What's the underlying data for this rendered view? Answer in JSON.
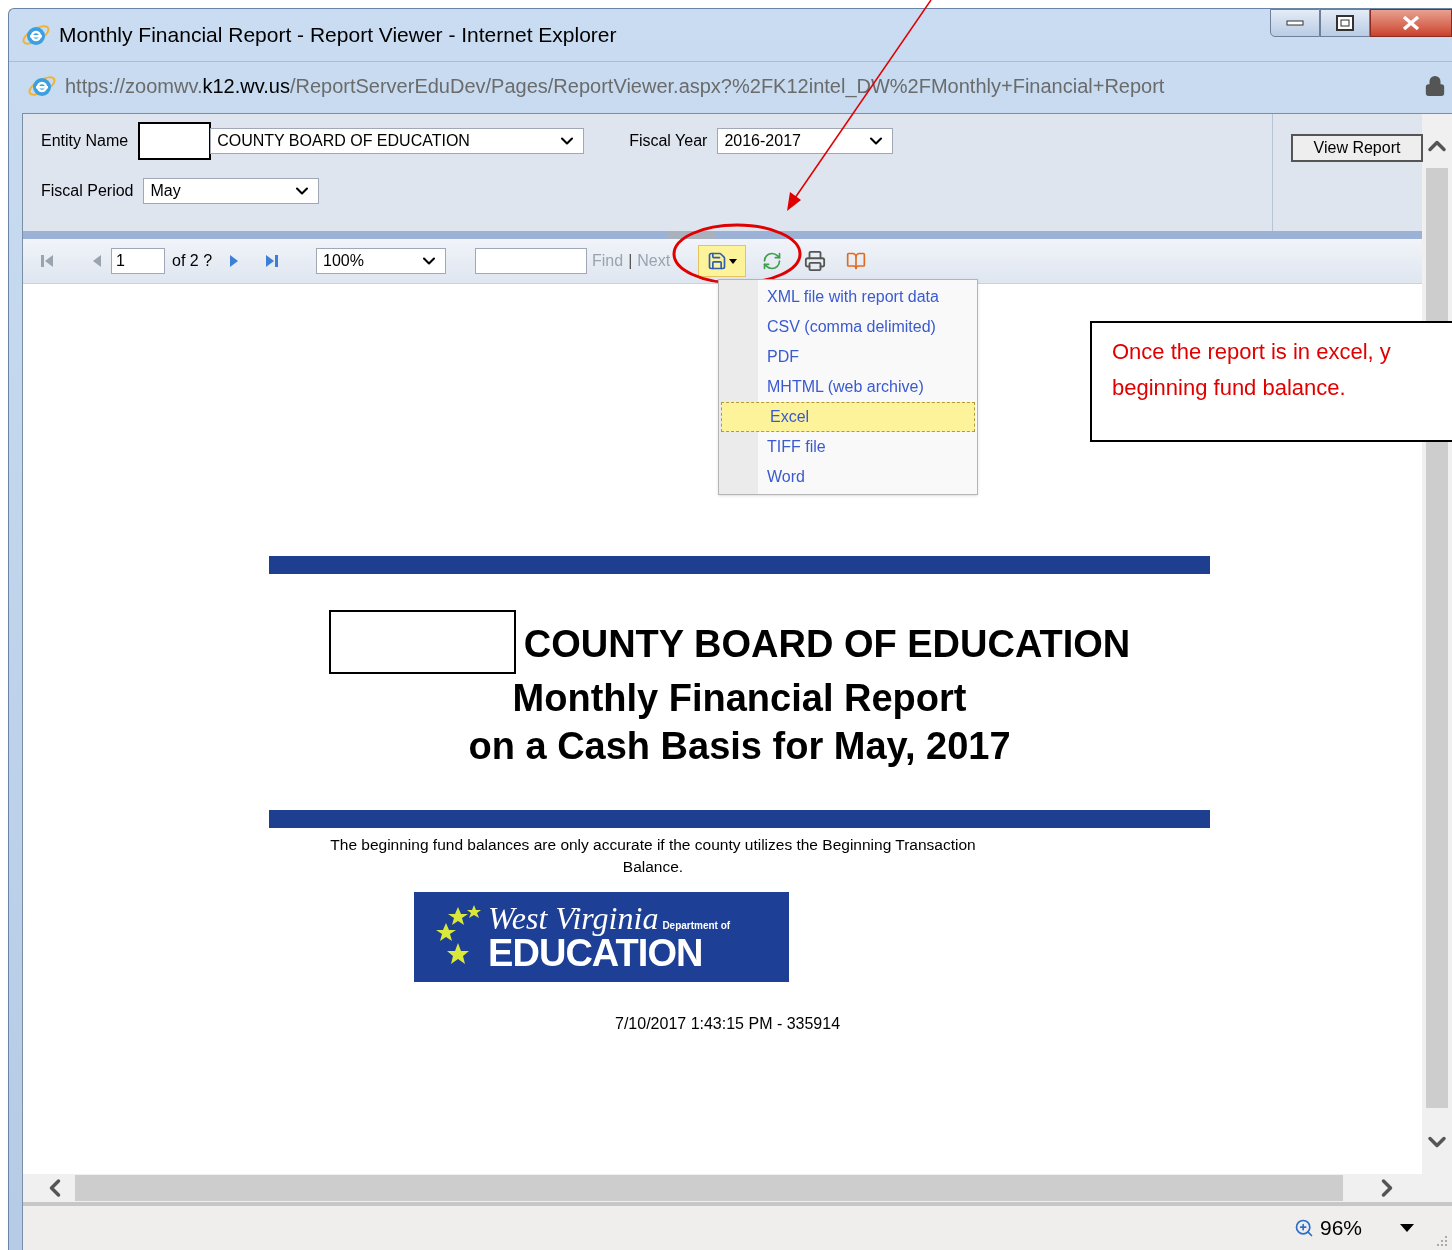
{
  "window": {
    "title": "Monthly Financial Report - Report Viewer - Internet Explorer"
  },
  "address_bar": {
    "url_parts": [
      {
        "text": "https://zoomwv.",
        "emphasis": false
      },
      {
        "text": "k12.wv.us",
        "emphasis": true
      },
      {
        "text": "/ReportServerEduDev/Pages/ReportViewer.aspx?%2FK12intel_DW%2FMonthly+Financial+Report",
        "emphasis": false
      }
    ]
  },
  "parameters": [
    {
      "label": "Entity Name",
      "value": "COUNTY BOARD OF EDUCATION",
      "redacted": true
    },
    {
      "label": "Fiscal Year",
      "value": "2016-2017"
    },
    {
      "label": "Fiscal Period",
      "value": "May"
    }
  ],
  "view_report_button": "View Report",
  "toolbar": {
    "page": "1",
    "page_count": "of 2 ?",
    "zoom": "100%",
    "find": {
      "label": "Find",
      "disabled": true
    },
    "separator": "|",
    "next": {
      "label": "Next",
      "disabled": true
    }
  },
  "export_menu": {
    "open": true,
    "items": [
      {
        "label": "XML file with report data",
        "selected": false
      },
      {
        "label": "CSV (comma delimited)",
        "selected": false
      },
      {
        "label": "PDF",
        "selected": false
      },
      {
        "label": "MHTML (web archive)",
        "selected": false
      },
      {
        "label": "Excel",
        "selected": true
      },
      {
        "label": "TIFF file",
        "selected": false
      },
      {
        "label": "Word",
        "selected": false
      }
    ]
  },
  "report": {
    "title_lines": [
      "COUNTY BOARD OF EDUCATION",
      "Monthly Financial Report",
      "on a Cash Basis for May, 2017"
    ],
    "title_redacted": true,
    "note": "The beginning fund balances are only accurate if the county utilizes the Beginning Transaction Balance.",
    "logo": {
      "script": "West Virginia",
      "small": "Department of",
      "big": "EDUCATION"
    },
    "timestamp": "7/10/2017 1:43:15 PM - 335914"
  },
  "status_bar": {
    "zoom": "96%"
  },
  "annotation": {
    "callout_lines": [
      "Once the report is in excel, y",
      "beginning fund balance."
    ]
  }
}
